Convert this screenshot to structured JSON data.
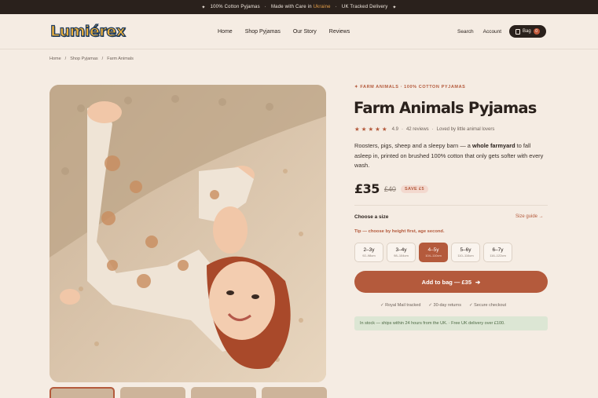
{
  "announcement": {
    "item1": "100% Cotton Pyjamas",
    "item2_prefix": "Made with Care in",
    "item2_accent": "Ukraine",
    "item3": "UK Tracked Delivery",
    "sep": "·",
    "star": "✦"
  },
  "header": {
    "logo": "Lumiérex",
    "nav": [
      "Home",
      "Shop Pyjamas",
      "Our Story",
      "Reviews"
    ],
    "search": "Search",
    "account": "Account",
    "bag_label": "Bag",
    "bag_count": "0"
  },
  "breadcrumb": [
    "Home",
    "Shop Pyjamas",
    "Farm Animals"
  ],
  "breadcrumb_sep": "/",
  "product": {
    "eyebrow": "✦  FARM ANIMALS · 100% COTTON PYJAMAS",
    "title": "Farm Animals Pyjamas",
    "stars": "★★★★★",
    "rating": "4.9",
    "reviews": "42 reviews",
    "loved": "Loved by little animal lovers",
    "desc_before": "Roosters, pigs, sheep and a sleepy barn — a ",
    "desc_bold": "whole farmyard",
    "desc_after": " to fall asleep in, printed on brushed 100% cotton that only gets softer with every wash.",
    "price": "£35",
    "old_price": "£40",
    "save": "SAVE £5",
    "size_label": "Choose a size",
    "size_guide": "Size guide  →",
    "tip": "Tip — choose by height first, age second.",
    "sizes": [
      {
        "label": "2–3y",
        "sub": "92–98cm"
      },
      {
        "label": "3–4y",
        "sub": "98–104cm"
      },
      {
        "label": "4–5y",
        "sub": "104–110cm"
      },
      {
        "label": "5–6y",
        "sub": "110–116cm"
      },
      {
        "label": "6–7y",
        "sub": "116–122cm"
      }
    ],
    "selected_size": "4–5y",
    "cta": "Add to bag — £35",
    "assurances": [
      "✓  Royal Mail tracked",
      "✓  30-day returns",
      "✓  Secure checkout"
    ],
    "stock": "In stock — ships within 24 hours from the UK.  ·  Free UK delivery over £100."
  },
  "colors": {
    "accent": "#b45a3c",
    "dark": "#2a211c",
    "background": "#f5ece3",
    "stock_bg": "#dce6d4"
  }
}
